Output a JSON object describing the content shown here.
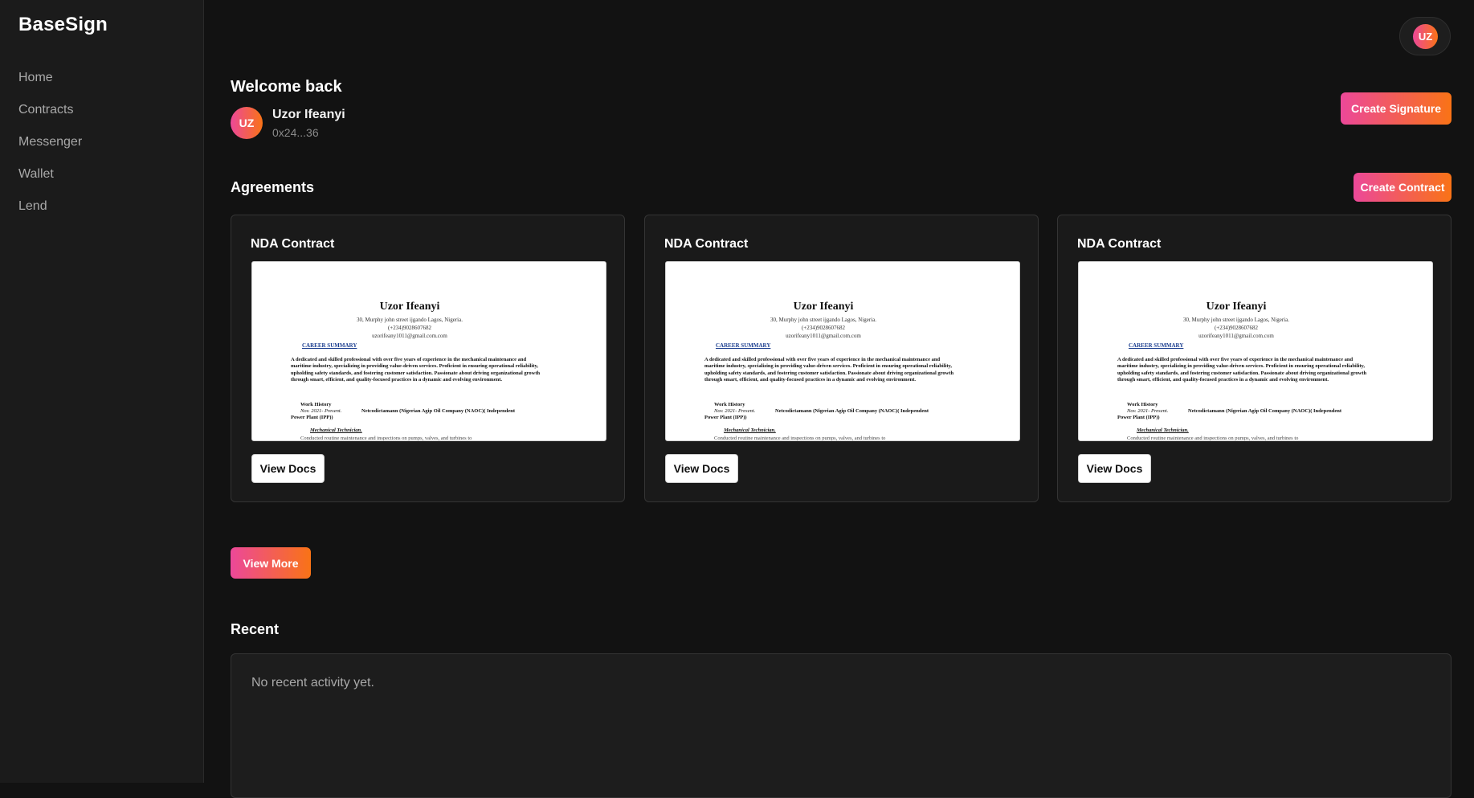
{
  "app": {
    "brand": "BaseSign"
  },
  "sidebar": {
    "items": [
      {
        "label": "Home"
      },
      {
        "label": "Contracts"
      },
      {
        "label": "Messenger"
      },
      {
        "label": "Wallet"
      },
      {
        "label": "Lend"
      }
    ]
  },
  "topbar": {
    "avatar_initials": "UZ"
  },
  "welcome": {
    "title": "Welcome back",
    "avatar_initials": "UZ",
    "user_name": "Uzor Ifeanyi",
    "wallet_address": "0x24...36"
  },
  "buttons": {
    "create_signature": "Create Signature",
    "create_contract": "Create Contract",
    "view_more": "View More"
  },
  "agreements": {
    "title": "Agreements",
    "cards": [
      {
        "title": "NDA Contract",
        "button_label": "View Docs"
      },
      {
        "title": "NDA Contract",
        "button_label": "View Docs"
      },
      {
        "title": "NDA Contract",
        "button_label": "View Docs"
      }
    ]
  },
  "document_preview": {
    "name": "Uzor Ifeanyi",
    "address": "30, Murphy john street ijgando Lagos, Nigeria.",
    "phone": "(+234)9028607682",
    "email": "uzorifeany1011@gmail.com.com",
    "career_heading": "CAREER SUMMARY",
    "summary": "A dedicated and skilled professional with over five years of experience in the mechanical maintenance and maritime industry, specializing in providing value-driven services. Proficient in ensuring operational reliability, upholding safety standards, and fostering customer satisfaction. Passionate about driving organizational growth through smart, efficient, and quality-focused practices in a dynamic and evolving environment.",
    "work_history_heading": "Work History",
    "work_date": "Nov. 2021- Present.",
    "work_company": "Netcodictamann (Nigerian Agip Oil Company (NAOC)( Independent",
    "work_plant": "Power Plant (IPP))",
    "role": "Mechanical Technician.",
    "duty": "Conducted routine maintenance and inspections on pumps, valves, and turbines to"
  },
  "recent": {
    "title": "Recent",
    "empty_text": "No recent activity yet."
  },
  "colors": {
    "background": "#121212",
    "sidebar": "#1b1b1b",
    "card": "#1a1a1a",
    "accent_start": "#ec4899",
    "accent_end": "#f97316"
  }
}
